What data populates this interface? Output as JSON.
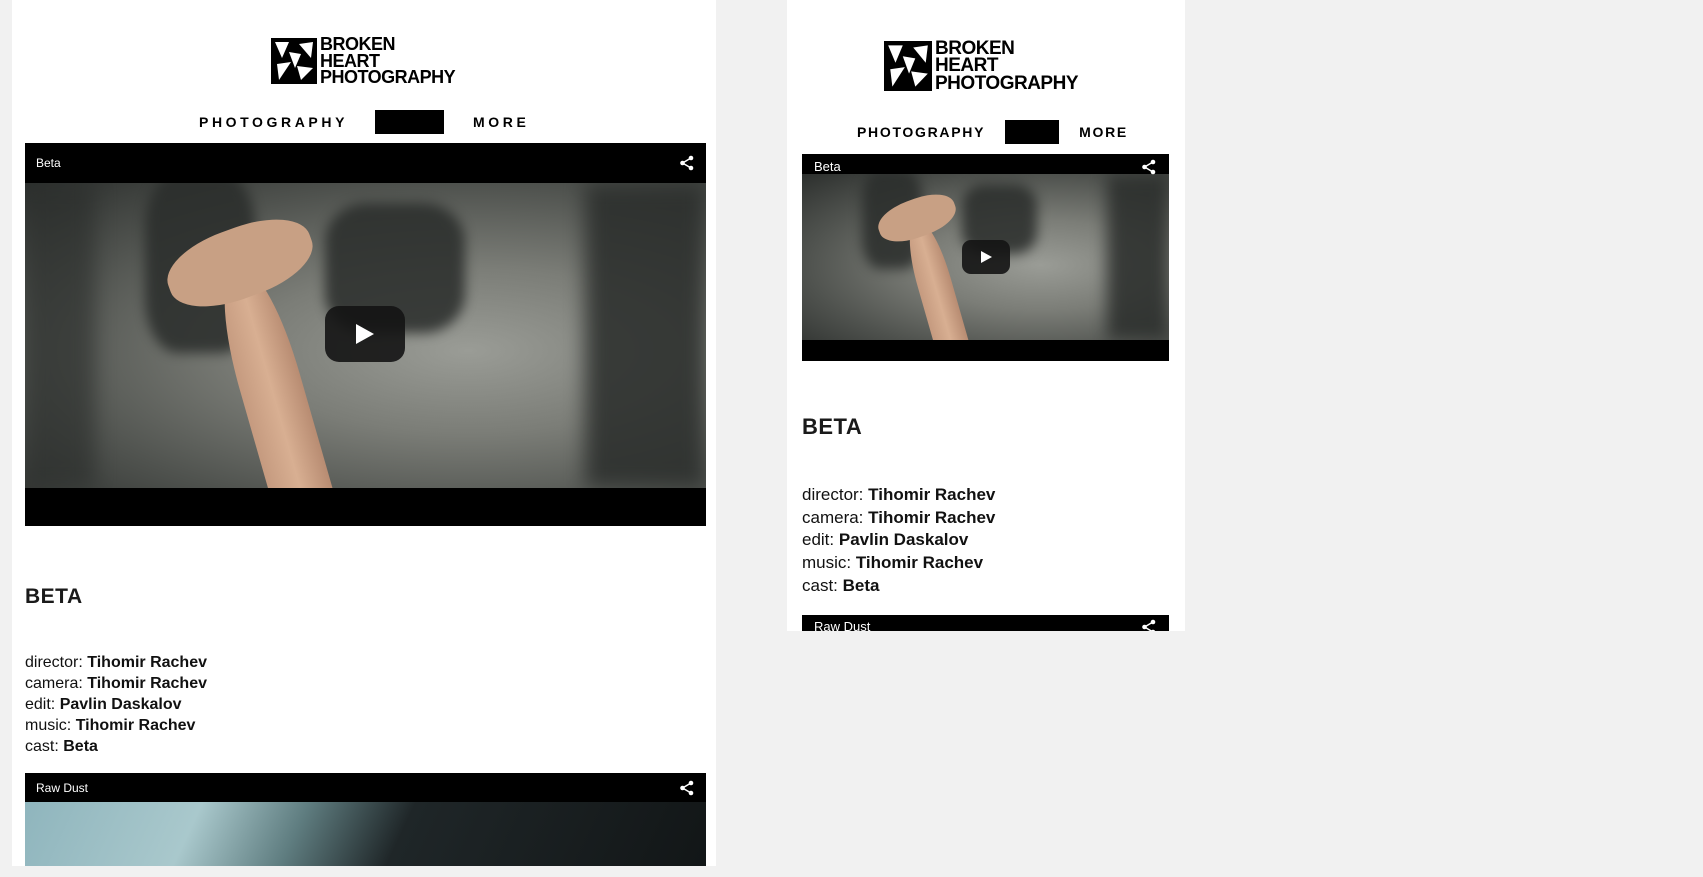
{
  "brand": {
    "line1": "BROKEN",
    "line2": "HEART",
    "line3": "PHOTOGRAPHY"
  },
  "nav": {
    "item1": "PHOTOGRAPHY",
    "item2": "MORE"
  },
  "videos": [
    {
      "title": "Beta",
      "icon": "share-icon"
    },
    {
      "title": "Raw Dust",
      "icon": "share-icon"
    }
  ],
  "project": {
    "heading": "BETA",
    "credits": [
      {
        "label": "director:",
        "value": "Tihomir Rachev"
      },
      {
        "label": "camera:",
        "value": "Tihomir Rachev"
      },
      {
        "label": "edit:",
        "value": "Pavlin Daskalov"
      },
      {
        "label": "music:",
        "value": "Tihomir Rachev"
      },
      {
        "label": "cast:",
        "value": "Beta"
      }
    ]
  }
}
